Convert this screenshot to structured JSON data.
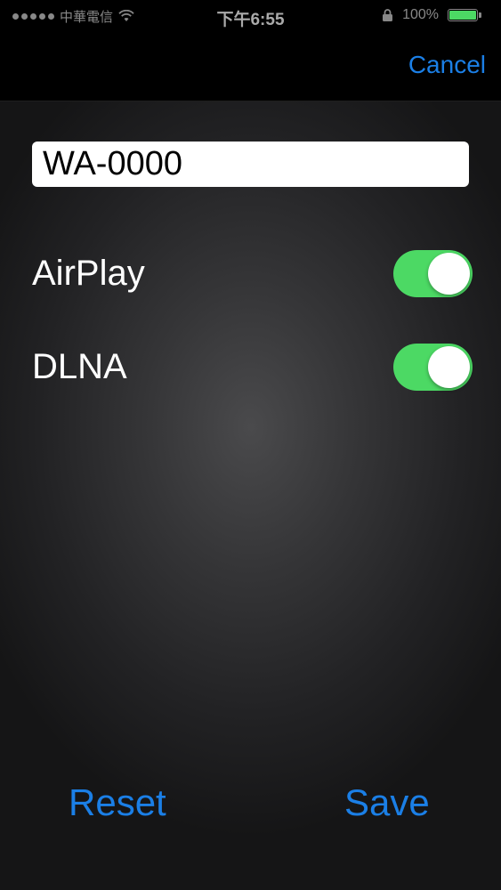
{
  "status_bar": {
    "carrier": "中華電信",
    "time": "下午6:55",
    "battery_percent": "100%",
    "battery_level": 1.0,
    "battery_color": "#4cd964"
  },
  "nav": {
    "cancel_label": "Cancel"
  },
  "device": {
    "name_value": "WA-0000"
  },
  "toggles": [
    {
      "label": "AirPlay",
      "on": true
    },
    {
      "label": "DLNA",
      "on": true
    }
  ],
  "actions": {
    "reset_label": "Reset",
    "save_label": "Save"
  },
  "colors": {
    "accent": "#1b7fe6",
    "toggle_on": "#4cd964"
  }
}
